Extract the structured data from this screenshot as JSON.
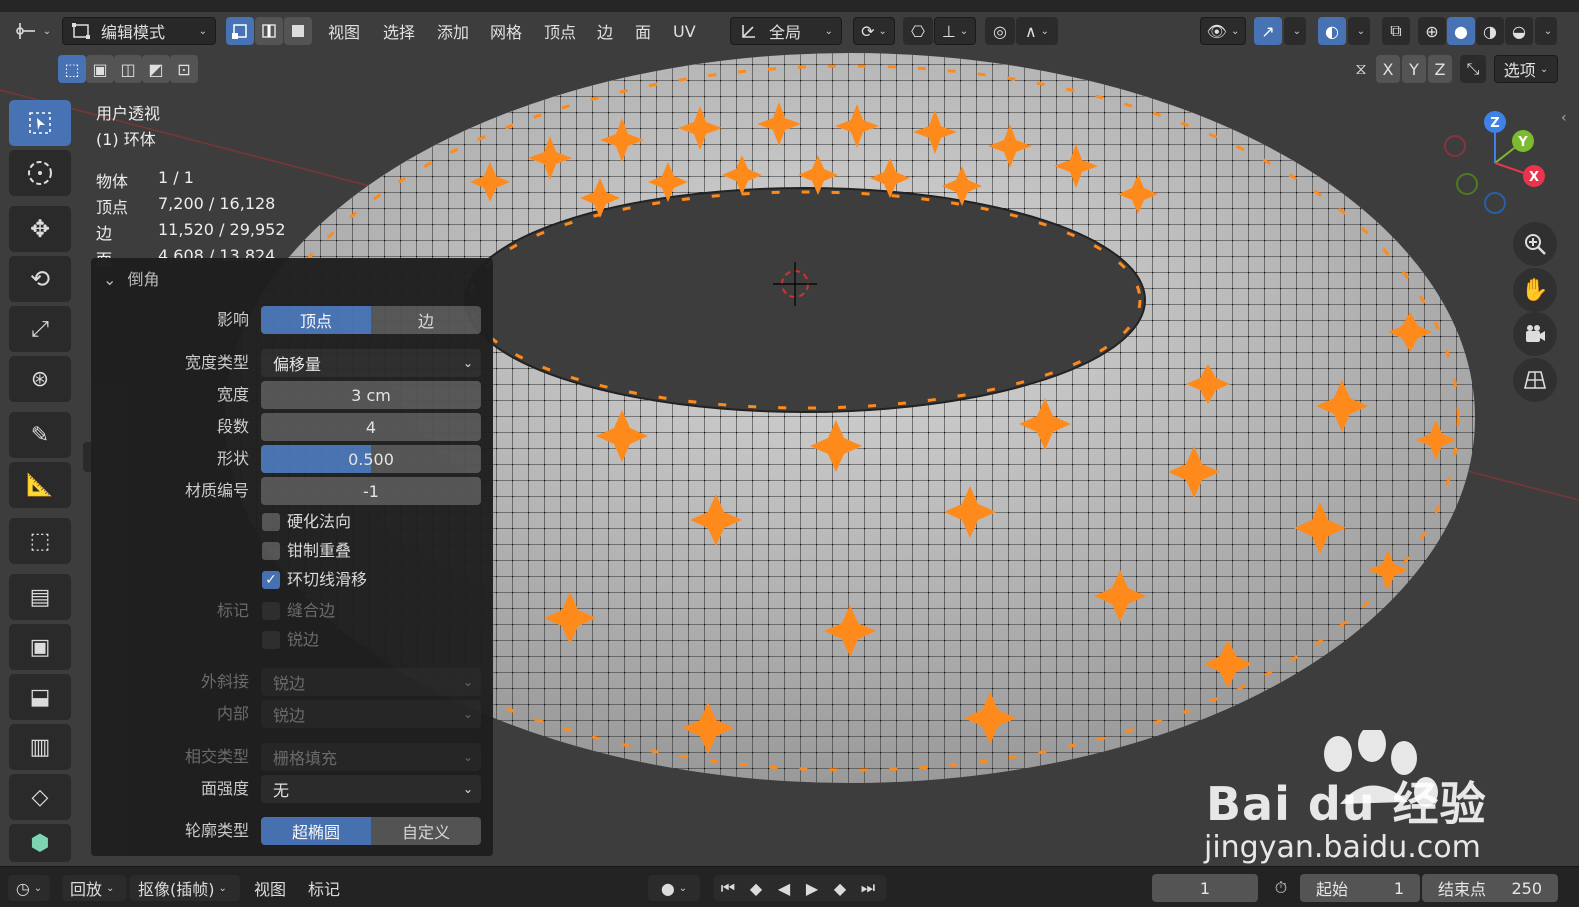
{
  "header": {
    "mode": "编辑模式",
    "menus": [
      "视图",
      "选择",
      "添加",
      "网格",
      "顶点",
      "边",
      "面",
      "UV"
    ],
    "transform_orientation": "全局",
    "options_label": "选项",
    "axes": [
      "X",
      "Y",
      "Z"
    ]
  },
  "overlay": {
    "view_name": "用户透视",
    "object_name": "(1) 环体",
    "stats": [
      {
        "label": "物体",
        "value": "1 / 1"
      },
      {
        "label": "顶点",
        "value": "7,200 / 16,128"
      },
      {
        "label": "边",
        "value": "11,520 / 29,952"
      },
      {
        "label": "面",
        "value": "4,608 / 13,824"
      }
    ]
  },
  "gizmo": {
    "z": "Z",
    "y": "Y",
    "x": "X"
  },
  "panel": {
    "title": "倒角",
    "affect_label": "影响",
    "affect_options": [
      "顶点",
      "边"
    ],
    "affect_selected": "顶点",
    "width_type_label": "宽度类型",
    "width_type_value": "偏移量",
    "width_label": "宽度",
    "width_value": "3 cm",
    "segments_label": "段数",
    "segments_value": "4",
    "shape_label": "形状",
    "shape_value": "0.500",
    "shape_fraction": 0.5,
    "material_label": "材质编号",
    "material_value": "-1",
    "harden_normals": "硬化法向",
    "clamp_overlap": "钳制重叠",
    "loop_slide": "环切线滑移",
    "mark_label": "标记",
    "mark_seam": "缝合边",
    "mark_sharp": "锐边",
    "miter_outer_label": "外斜接",
    "miter_outer_value": "锐边",
    "miter_inner_label": "内部",
    "miter_inner_value": "锐边",
    "intersection_label": "相交类型",
    "intersection_value": "栅格填充",
    "face_strength_label": "面强度",
    "face_strength_value": "无",
    "profile_label": "轮廓类型",
    "profile_options": [
      "超椭圆",
      "自定义"
    ],
    "profile_selected": "超椭圆"
  },
  "timeline": {
    "playback": "回放",
    "keying": "抠像(插帧)",
    "view": "视图",
    "marker": "标记",
    "current_frame": "1",
    "start_label": "起始",
    "start_value": "1",
    "end_label": "结束点",
    "end_value": "250"
  },
  "watermark": {
    "brand": "Bai du 经验",
    "url": "jingyan.baidu.com"
  },
  "colors": {
    "accent": "#4772b3",
    "selection": "#ff8a1c",
    "viewport": "#3d3d3d"
  }
}
